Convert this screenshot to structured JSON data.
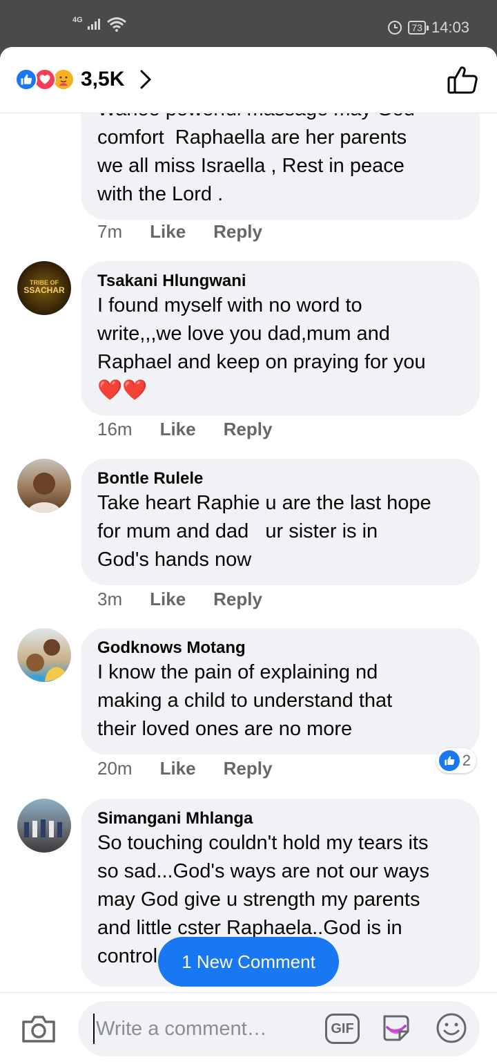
{
  "status": {
    "network": "4G",
    "battery": "73",
    "time": "14:03"
  },
  "header": {
    "reaction_count": "3,5K"
  },
  "comments": [
    {
      "name": "",
      "text": "Wahoo powerful massage may God\ncomfort  Raphaella are her parents\nwe all miss Israella , Rest in peace\nwith the Lord .",
      "time": "7m",
      "like": "Like",
      "reply": "Reply"
    },
    {
      "name": "Tsakani Hlungwani",
      "text": "I found myself with no word to\nwrite,,,we love you dad,mum and\nRaphael and keep on praying for you\n❤️❤️",
      "time": "16m",
      "like": "Like",
      "reply": "Reply",
      "avatar_text": "TRIBE OF ISSACHAR"
    },
    {
      "name": "Bontle Rulele",
      "text": "Take heart Raphie u are the last hope\nfor mum and dad   ur sister is in\nGod's hands now",
      "time": "3m",
      "like": "Like",
      "reply": "Reply"
    },
    {
      "name": "Godknows Motang",
      "text": "I know the pain of explaining nd\nmaking a child to understand that\ntheir loved ones are no more",
      "time": "20m",
      "like": "Like",
      "reply": "Reply",
      "reactions": "2"
    },
    {
      "name": "Simangani Mhlanga",
      "text": "So touching couldn't hold my tears its\nso sad...God's ways are not our ways\nmay God give u strength my parents\nand little cster Raphaela..God is in\ncontrol",
      "time": "",
      "like": "",
      "reply": ""
    }
  ],
  "new_comment_label": "1 New Comment",
  "composer": {
    "placeholder": "Write a comment…",
    "gif_label": "GIF"
  },
  "colors": {
    "accent": "#1877f2",
    "bubble": "#f0f2f5",
    "love": "#f33e58"
  }
}
